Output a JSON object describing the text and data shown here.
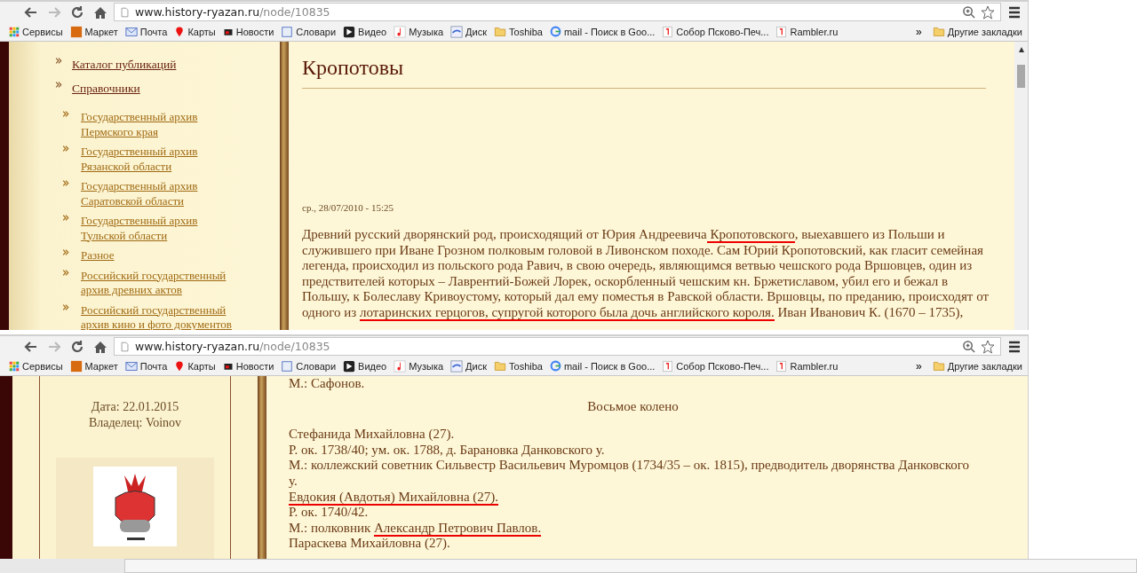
{
  "windows": [
    {
      "kind": "article",
      "url_host": "www.history-ryazan.ru",
      "url_path": "/node/10835",
      "more": "»",
      "other_bookmarks": "Другие закладки",
      "bookmarks": [
        "Сервисы",
        "Маркет",
        "Почта",
        "Карты",
        "Новости",
        "Словари",
        "Видео",
        "Музыка",
        "Диск",
        "Toshiba",
        "mail - Поиск в Goo...",
        "Собор Псково-Печ...",
        "Rambler.ru"
      ],
      "sidebar": [
        {
          "label": "Каталог публикаций"
        },
        {
          "label": "Справочники",
          "children": [
            {
              "label": "Государственный архив Пермского края"
            },
            {
              "label": "Государственный архив Рязанской области"
            },
            {
              "label": "Государственный архив Саратовской области"
            },
            {
              "label": "Государственный архив Тульской области"
            },
            {
              "label": "Разное"
            },
            {
              "label": "Российский государственный архив древних актов"
            },
            {
              "label": "Российский государственный архив кино и фото документов"
            }
          ]
        }
      ],
      "title": "Кропотовы",
      "date": "ср., 28/07/2010 - 15:25",
      "paragraph": [
        {
          "text": "Древний русский дворянский род, происходящий от Юрия Андреевича",
          "underlined": false
        },
        {
          "text": " Кропотовского",
          "underlined": true
        },
        {
          "text": ", выехавшего из Польши и служившего при Иване Грозном полковым головой в Ливонском походе. Сам Юрий Кропотовский, как гласит семейная легенда, происходил из польского рода Равич, в свою очередь, являющимся ветвью чешского рода Вршовцев, один из предствителей которых – Лаврентий-Божей Лорек, оскорбленный чешским кн. Бржетиславом, убил его и бежал в Польшу, к Болеславу Кривоустому, который дал ему поместья в Равской области. Вршовцы, по преданию, происходят от одного из ",
          "underlined": false
        },
        {
          "text": "лотаринских герцогов, супругой которого была дочь английского короля.",
          "underlined": true
        },
        {
          "text": " Иван Иванович К. (1670 – 1735),",
          "underlined": false
        }
      ]
    },
    {
      "kind": "genealogy",
      "url_host": "www.history-ryazan.ru",
      "url_path": "/node/10835",
      "more": "»",
      "other_bookmarks": "Другие закладки",
      "bookmarks": [
        "Сервисы",
        "Маркет",
        "Почта",
        "Карты",
        "Новости",
        "Словари",
        "Видео",
        "Музыка",
        "Диск",
        "Toshiba",
        "mail - Поиск в Goo...",
        "Собор Псково-Печ...",
        "Rambler.ru"
      ],
      "info": [
        "Дата: 22.01.2015",
        "Владелец: Voinov"
      ],
      "cut_line": "М.: Сафонов.",
      "heading": "Восьмое колено",
      "lines": [
        [
          {
            "text": "Стефанида Михайловна (27).",
            "underlined": false
          }
        ],
        [
          {
            "text": "Р. ок. 1738/40; ум. ок. 1788, д. Барановка Данковского у.",
            "underlined": false
          }
        ],
        [
          {
            "text": "М.: коллежский советник Сильвестр Васильевич Муромцов (1734/35 – ок. 1815), предводитель дворянства Данковского у.",
            "underlined": false
          }
        ],
        [
          {
            "text": "Евдокия (Авдотья) Михайловна (27).",
            "underlined": true
          }
        ],
        [
          {
            "text": "Р. ок. 1740/42.",
            "underlined": false
          }
        ],
        [
          {
            "text": "М.: полковник ",
            "underlined": false
          },
          {
            "text": "Александр Петрович Павлов.",
            "underlined": true
          }
        ],
        [
          {
            "text": "Параскева Михайловна (27).",
            "underlined": false
          }
        ]
      ]
    }
  ]
}
